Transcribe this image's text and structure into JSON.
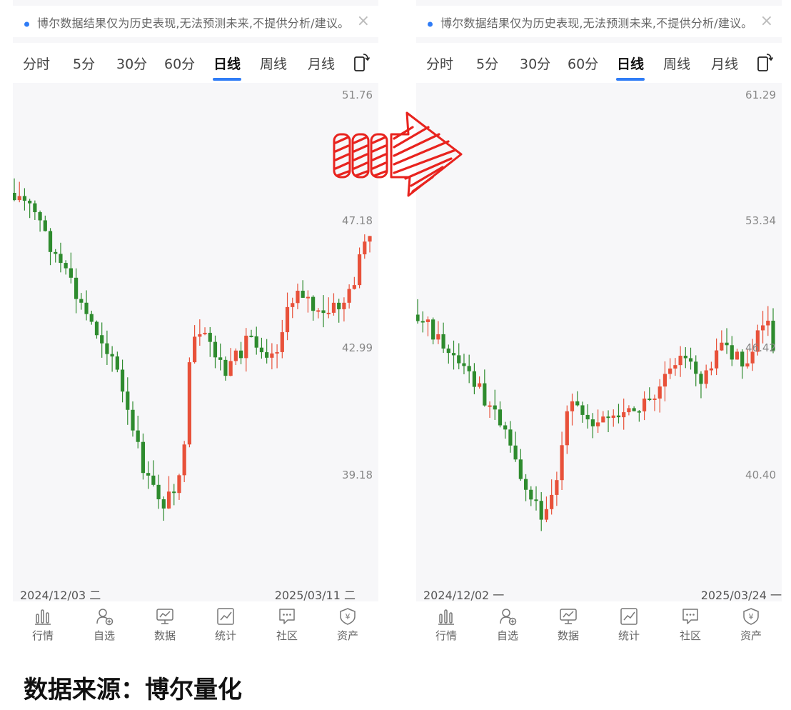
{
  "notice": {
    "text": "博尔数据结果仅为历史表现,无法预测未来,不提供分析/建议。",
    "close": "×"
  },
  "tabs": [
    "分时",
    "5分",
    "30分",
    "60分",
    "日线",
    "周线",
    "月线"
  ],
  "active_tab": "日线",
  "nav": [
    {
      "label": "行情",
      "icon": "bar-chart-icon"
    },
    {
      "label": "自选",
      "icon": "user-add-icon"
    },
    {
      "label": "数据",
      "icon": "monitor-chart-icon"
    },
    {
      "label": "统计",
      "icon": "line-chart-icon"
    },
    {
      "label": "社区",
      "icon": "chat-bubble-icon"
    },
    {
      "label": "资产",
      "icon": "yuan-shield-icon"
    }
  ],
  "colors": {
    "up": "#e8513a",
    "down": "#2e8b2e",
    "accent": "#2f7cf6",
    "arrow": "#e8231e"
  },
  "left_chart": {
    "price_labels": [
      "51.76",
      "47.18",
      "42.99",
      "39.18"
    ],
    "date_start": "2024/12/03 二",
    "date_end": "2025/03/11 二"
  },
  "right_chart": {
    "price_labels": [
      "61.29",
      "53.34",
      "46.42",
      "40.40"
    ],
    "date_start": "2024/12/02 一",
    "date_end": "2025/03/24 一"
  },
  "footer": {
    "source": "数据来源：博尔量化"
  }
}
